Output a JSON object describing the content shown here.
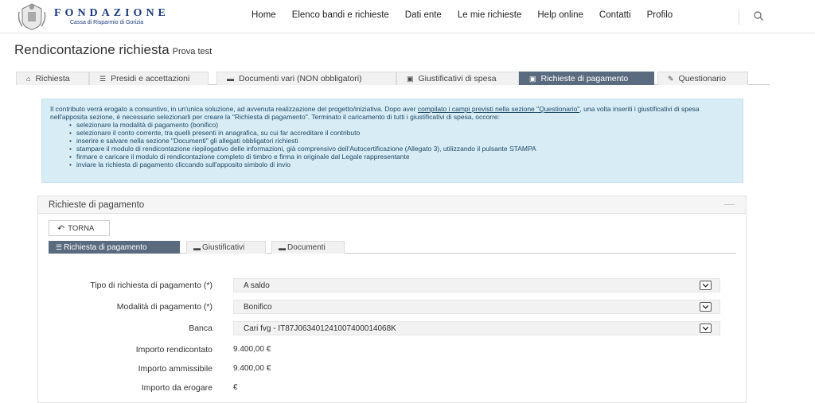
{
  "header": {
    "logo_title": "FONDAZIONE",
    "logo_subtitle": "Cassa di Risparmio di Gorizia",
    "nav": [
      "Home",
      "Elenco bandi e richieste",
      "Dati ente",
      "Le mie richieste",
      "Help online",
      "Contatti",
      "Profilo"
    ],
    "search_icon": "search-icon"
  },
  "page": {
    "title": "Rendicontazione richiesta",
    "subtitle": "Prova test"
  },
  "main_tabs": [
    {
      "label": "Richiesta",
      "icon": "home-icon"
    },
    {
      "label": "Presidi e accettazioni",
      "icon": "list-icon"
    },
    {
      "label": "Documenti vari (NON obbligatori)",
      "icon": "folder-icon"
    },
    {
      "label": "Giustificativi di spesa",
      "icon": "money-icon"
    },
    {
      "label": "Richieste di pagamento",
      "icon": "money-icon",
      "active": true
    },
    {
      "label": "Questionario",
      "icon": "pencil-icon"
    }
  ],
  "info": {
    "intro_a": "Il contributo verrà erogato a consuntivo, in un'unica soluzione, ad avvenuta realizzazione del progetto/iniziativa. Dopo aver",
    "link_1": "compilato i campi previsti nella sezione",
    "link_2": "\"Questionario\"",
    "intro_b": ", una volta inseriti i giustificativi di spesa nell'apposita sezione, è necessario selezionarli per creare la \"Richiesta di pagamento\". Terminato il caricamento di tutti i giustificativi di spesa, occorre:",
    "items": [
      "selezionare la modalità di pagamento (bonifico)",
      "selezionare il conto corrente, tra quelli presenti in anagrafica, su cui far accreditare il contributo",
      "inserire e salvare nella sezione \"Documenti\" gli allegati obbligatori richiesti",
      "stampare il modulo di rendicontazione riepilogativo delle informazioni, già comprensivo dell'Autocertificazione (Allegato 3), utilizzando il pulsante STAMPA",
      "firmare e caricare il modulo di rendicontazione completo di timbro e firma in originale dal Legale rappresentante",
      "inviare la richiesta di pagamento cliccando sull'apposito simbolo di invio"
    ]
  },
  "panel": {
    "title": "Richieste di pagamento",
    "minimize": "—",
    "back_label": "TORNA",
    "sub_tabs": [
      {
        "label": "Richiesta di pagamento",
        "icon": "list-icon",
        "active": true
      },
      {
        "label": "Giustificativi",
        "icon": "folder-icon"
      },
      {
        "label": "Documenti",
        "icon": "folder-icon"
      }
    ]
  },
  "form": {
    "tipo_label": "Tipo di richiesta di pagamento (*)",
    "tipo_value": "A saldo",
    "modalita_label": "Modalità di pagamento (*)",
    "modalita_value": "Bonifico",
    "banca_label": "Banca",
    "banca_value": "Cari fvg - IT87J0634012410074000140​68K",
    "importo_rend_label": "Importo rendicontato",
    "importo_rend_value": "9.400,00 €",
    "importo_amm_label": "Importo ammissibile",
    "importo_amm_value": "9.400,00 €",
    "importo_erog_label": "Importo da erogare",
    "importo_erog_value": "€"
  }
}
